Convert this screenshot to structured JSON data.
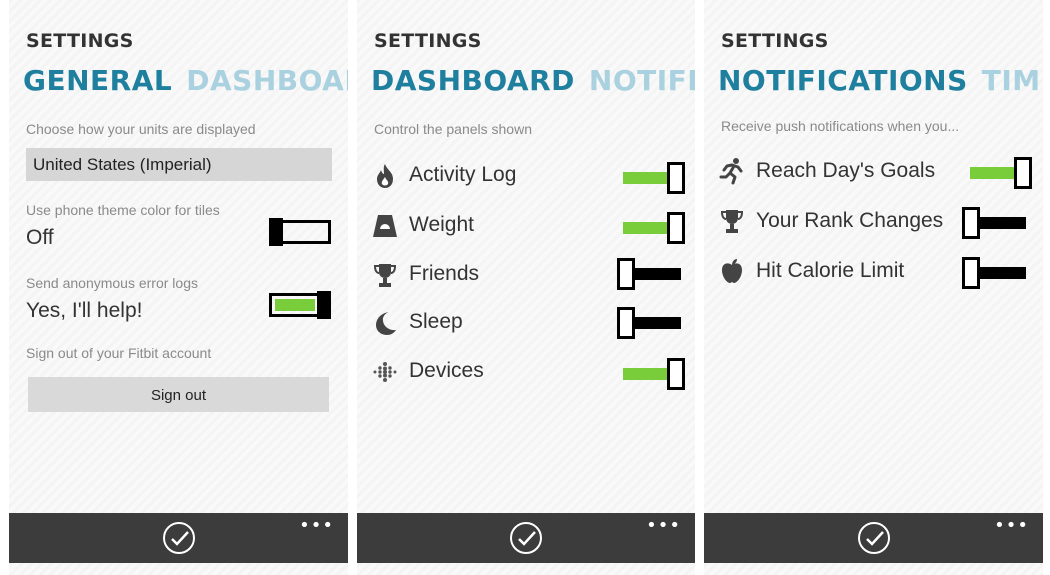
{
  "panels": {
    "general": {
      "title": "SETTINGS",
      "pivot_active": "GENERAL",
      "pivot_next": "DASHBOARD",
      "units_label": "Choose how your units are displayed",
      "units_value": "United States (Imperial)",
      "theme_label": "Use phone theme color for tiles",
      "theme_value": "Off",
      "theme_on": false,
      "errors_label": "Send anonymous error logs",
      "errors_value": "Yes, I'll help!",
      "errors_on": true,
      "signout_label": "Sign out of your Fitbit account",
      "signout_button": "Sign out"
    },
    "dashboard": {
      "title": "SETTINGS",
      "pivot_active": "DASHBOARD",
      "pivot_next": "NOTIFICA",
      "intro": "Control the panels shown",
      "items": [
        {
          "label": "Activity Log",
          "icon": "flame-icon",
          "on": true
        },
        {
          "label": "Weight",
          "icon": "scale-icon",
          "on": true
        },
        {
          "label": "Friends",
          "icon": "trophy-icon",
          "on": false
        },
        {
          "label": "Sleep",
          "icon": "moon-icon",
          "on": false
        },
        {
          "label": "Devices",
          "icon": "fitbit-dots-icon",
          "on": true
        }
      ]
    },
    "notifications": {
      "title": "SETTINGS",
      "pivot_active": "NOTIFICATIONS",
      "pivot_next": "TIME",
      "intro": "Receive push notifications when you...",
      "items": [
        {
          "label": "Reach Day's Goals",
          "icon": "runner-icon",
          "on": true
        },
        {
          "label": "Your Rank Changes",
          "icon": "trophy-icon",
          "on": false
        },
        {
          "label": "Hit Calorie Limit",
          "icon": "apple-icon",
          "on": false
        }
      ]
    }
  },
  "appbar": {
    "ok_icon": "checkmark-icon",
    "more_label": "•••"
  },
  "colors": {
    "accent": "#1f7f9e",
    "accent_light": "#a9d1df",
    "toggle_on": "#7acd3a",
    "appbar": "#3c3c3c"
  }
}
